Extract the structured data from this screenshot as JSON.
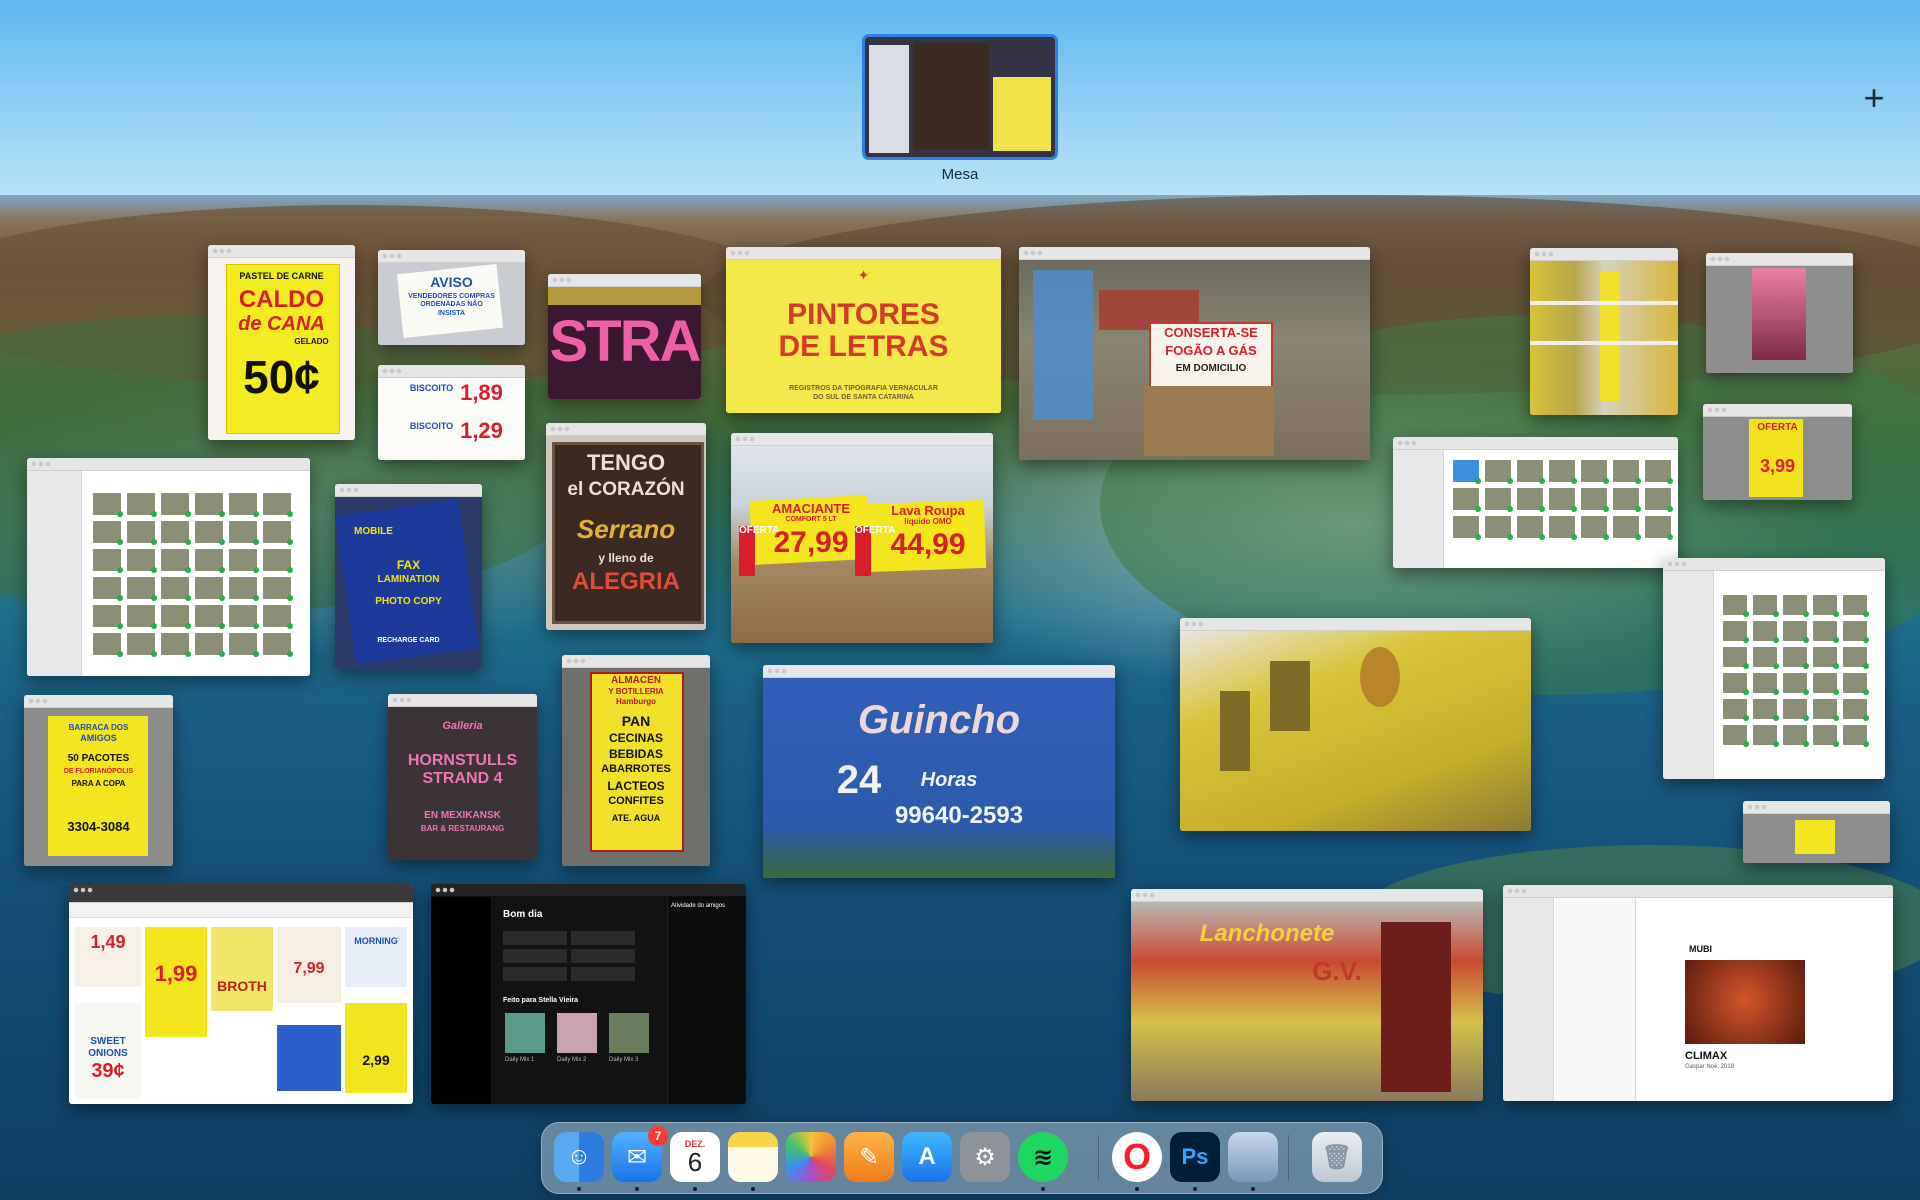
{
  "space": {
    "label": "Mesa",
    "add_symbol": "+"
  },
  "windows": {
    "caldo": {
      "line1": "PASTEL DE CARNE",
      "line2": "CALDO",
      "line3": "de CANA",
      "line4": "GELADO",
      "price": "50¢"
    },
    "aviso": {
      "title": "AVISO",
      "text": "VENDEDORES COMPRAS ORDENADAS NÃO INSISTA"
    },
    "biscoito": {
      "line1": "BISCOITO",
      "price1": "1,89",
      "line2": "BISCOITO",
      "price2": "1,29"
    },
    "stra": {
      "text": "STRA"
    },
    "pintores": {
      "title1": "PINTORES",
      "title2": "DE LETRAS",
      "subtitle": "REGISTROS DA TIPOGRAFIA VERNACULAR DO SUL DE SANTA CATARINA"
    },
    "conserta": {
      "text1": "CONSERTA-SE",
      "text2": "FOGÃO A GÁS",
      "text3": "EM DOMICILIO"
    },
    "tengo": {
      "line1": "TENGO",
      "line2": "el CORAZÓN",
      "line3": "Serrano",
      "line4": "y lleno de",
      "line5": "ALEGRIA"
    },
    "oferta_produtos": {
      "label1": "OFERTA",
      "name1": "AMACIANTE",
      "sub1": "COMFORT 5 LT",
      "price1": "27,99",
      "label2": "OFERTA",
      "name2": "Lava Roupa",
      "sub2": "líquido OMO",
      "price2": "44,99"
    },
    "mobile": {
      "line1": "MOBILE",
      "line2": "FAX",
      "line3": "LAMINATION",
      "line4": "PHOTO COPY",
      "line5": "RECHARGE CARD"
    },
    "almacen": {
      "line1": "ALMACEN",
      "line2": "Y BOTILLERIA",
      "line3": "Hamburgo",
      "line4": "PAN",
      "line5": "CECINAS",
      "line6": "BEBIDAS",
      "line7": "ABARROTES",
      "line8": "LACTEOS",
      "line9": "CONFITES",
      "line10": "ATE. AGUA"
    },
    "hornstulls": {
      "line1": "Galleria",
      "line2": "HORNSTULLS",
      "line3": "STRAND 4",
      "line4": "EN MEXIKANSK",
      "line5": "BAR & RESTAURANG"
    },
    "guincho": {
      "line1": "Guincho",
      "line2": "24",
      "line3": "Horas",
      "phone": "99640-2593"
    },
    "barraca": {
      "line1": "BARRACA DOS",
      "line2": "AMIGOS",
      "line3": "50 PACOTES",
      "line4": "DE FLORIANÓPOLIS",
      "line5": "PARA A COPA",
      "phone": "3304-3084"
    },
    "lanchonete": {
      "line1": "Lanchonete",
      "line2": "G.V."
    },
    "oferta_right": {
      "label": "OFERTA",
      "price": "3,99"
    },
    "climax": {
      "brand": "MUBI",
      "film": "CLIMAX",
      "credit": "Gaspar Noé, 2018"
    },
    "spotify": {
      "greeting": "Bom dia",
      "made_for": "Feito para Stella Vieira",
      "friends": "Atividade do amigos",
      "mixes": [
        "Daily Mix 1",
        "Daily Mix 2",
        "Daily Mix 3"
      ]
    },
    "pinterest": {
      "prices": [
        "1,49",
        "1,99",
        "2,99",
        "7,99",
        "39¢"
      ],
      "words": [
        "SWEET",
        "ONIONS",
        "MORNING",
        "BROTH"
      ]
    }
  },
  "dock": {
    "mail_badge": "7",
    "calendar_month": "DEZ.",
    "calendar_day": "6",
    "photoshop_label": "Ps",
    "items": [
      "Finder",
      "Mail",
      "Calendar",
      "Notes",
      "Photos",
      "Pages",
      "App Store",
      "System Preferences",
      "Spotify",
      "Opera",
      "Photoshop",
      "Preview",
      "Trash"
    ]
  },
  "colors": {
    "accent": "#2f80e6",
    "sign_yellow": "#f5e400",
    "sign_red": "#d81e2a"
  }
}
